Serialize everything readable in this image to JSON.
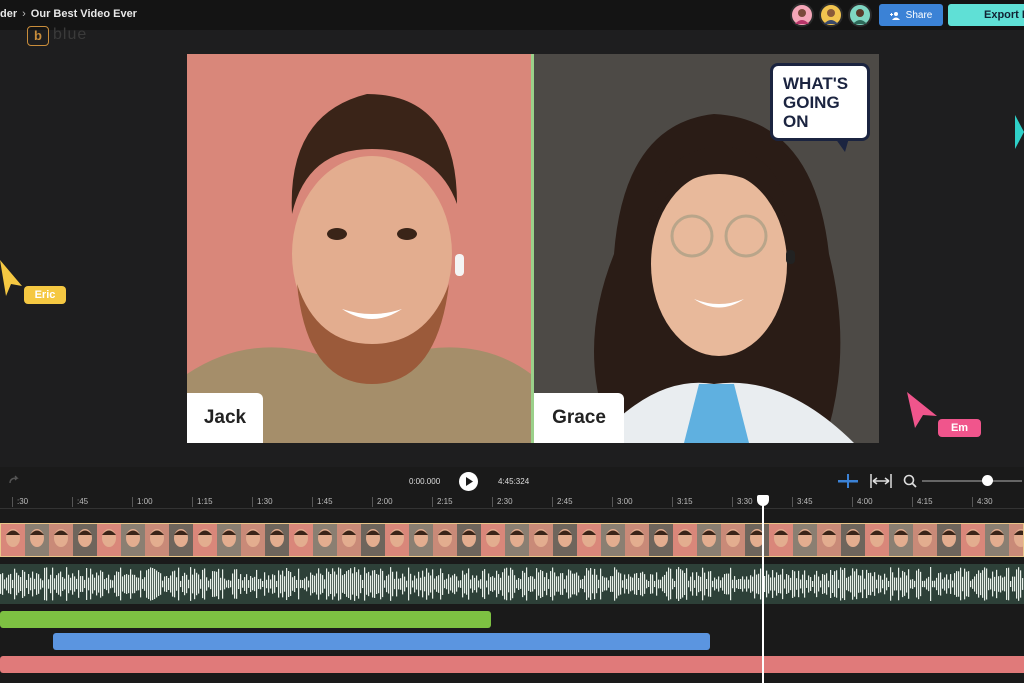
{
  "topbar": {
    "breadcrumb_parent": "der",
    "breadcrumb_sep": "›",
    "project_title": "Our Best Video Ever",
    "share_label": "Share",
    "export_label": "Export P"
  },
  "logo": {
    "mark": "b",
    "word": "blue"
  },
  "video": {
    "left_name": "Jack",
    "right_name": "Grace",
    "bubble_lines": [
      "WHAT'S",
      "GOING",
      "ON"
    ]
  },
  "cursors": [
    {
      "label": "Eric",
      "color": "#f5c842"
    },
    {
      "label": "Em",
      "color": "#f0558c"
    }
  ],
  "timeline": {
    "current_time": "0:00.000",
    "total_time": "4:45:324",
    "ruler": [
      ":30",
      ":45",
      "1:00",
      "1:15",
      "1:30",
      "1:45",
      "2:00",
      "2:15",
      "2:30",
      "2:45",
      "3:00",
      "3:15",
      "3:30",
      "3:45",
      "4:00",
      "4:15",
      "4:30"
    ],
    "zoom_level": 0.62
  },
  "colors": {
    "accent_share": "#3b82d6",
    "accent_export": "#5fe0d6",
    "clip_green": "#7dc142",
    "clip_blue": "#5b95e0",
    "clip_red": "#e07a7a"
  }
}
